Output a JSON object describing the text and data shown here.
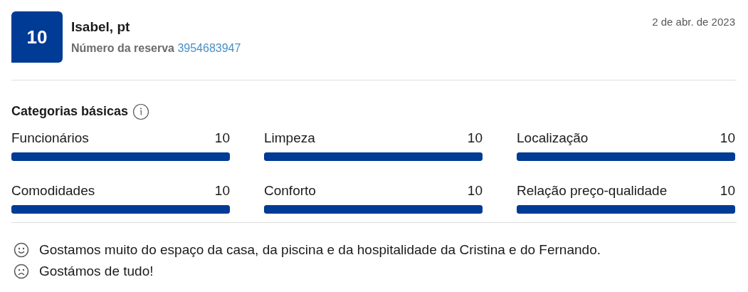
{
  "review": {
    "score": "10",
    "reviewer": "Isabel, pt",
    "booking_label": "Número da reserva",
    "booking_number": "3954683947",
    "date": "2 de abr. de 2023"
  },
  "categories": {
    "title": "Categorias básicas",
    "items": [
      {
        "name": "Funcionários",
        "score": "10",
        "level": 1
      },
      {
        "name": "Limpeza",
        "score": "10",
        "level": 1
      },
      {
        "name": "Localização",
        "score": "10",
        "level": 1
      },
      {
        "name": "Comodidades",
        "score": "10",
        "level": 1
      },
      {
        "name": "Conforto",
        "score": "10",
        "level": 1
      },
      {
        "name": "Relação preço-qualidade",
        "score": "10",
        "level": 1
      }
    ]
  },
  "comments": [
    {
      "kind": "positive",
      "text": "Gostamos muito do espaço da casa, da piscina e da hospitalidade da Cristina e do Fernando."
    },
    {
      "kind": "negative",
      "text": "Gostámos de tudo!"
    }
  ]
}
